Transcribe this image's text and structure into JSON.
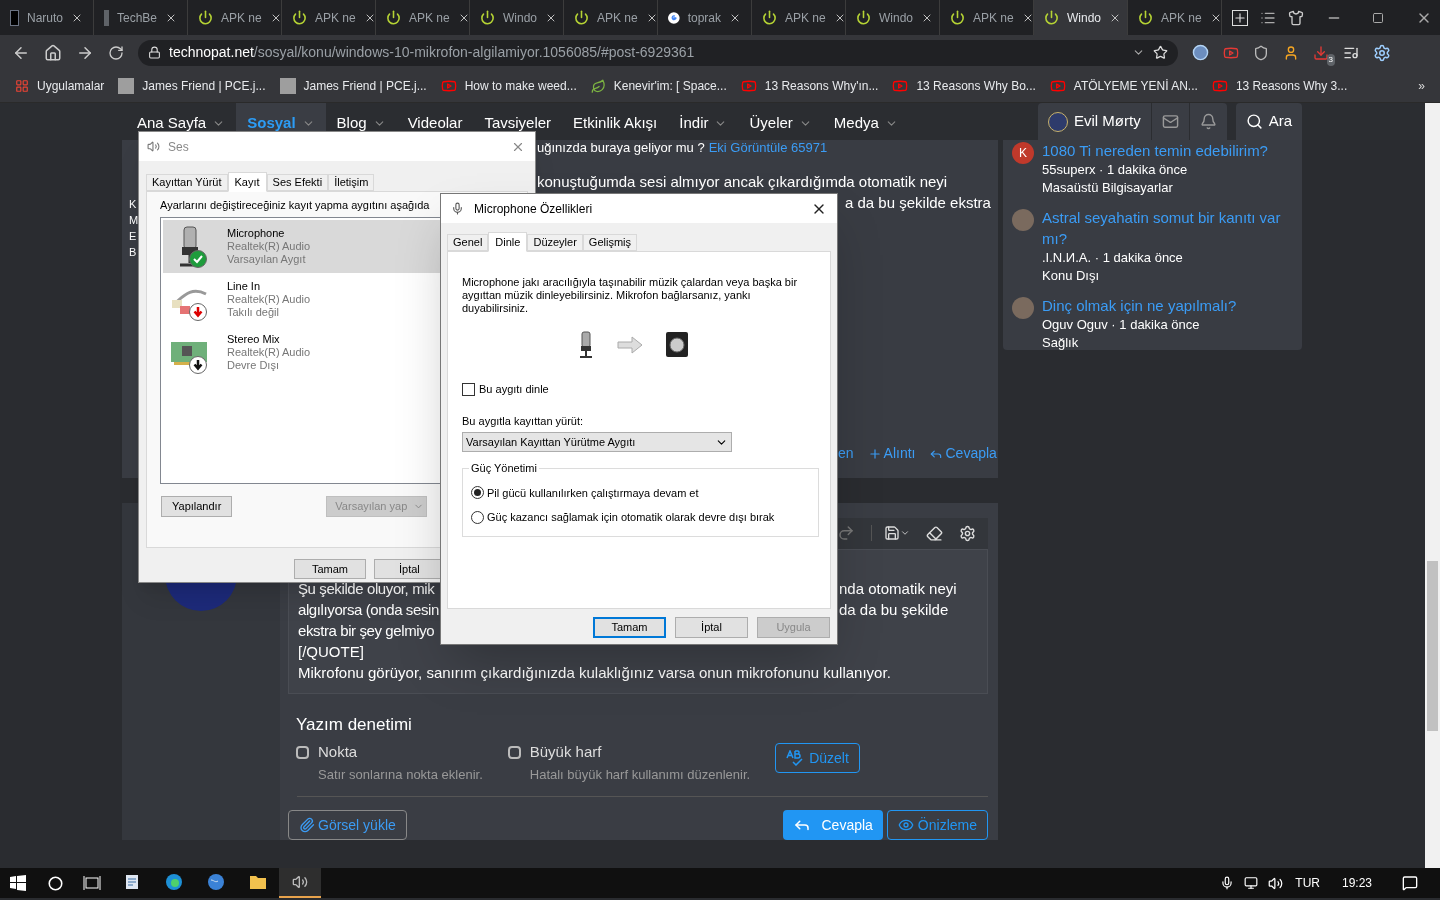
{
  "browser": {
    "tabs": [
      {
        "title": "Naruto",
        "kind": "logo",
        "selected": false
      },
      {
        "title": "TechBe",
        "kind": "blank",
        "selected": false
      },
      {
        "title": "APK ne",
        "kind": "power",
        "selected": false
      },
      {
        "title": "APK ne",
        "kind": "power",
        "selected": false
      },
      {
        "title": "APK ne",
        "kind": "power",
        "selected": false
      },
      {
        "title": "Windo",
        "kind": "power",
        "selected": false
      },
      {
        "title": "APK ne",
        "kind": "power",
        "selected": false
      },
      {
        "title": "toprak",
        "kind": "google",
        "selected": false
      },
      {
        "title": "APK ne",
        "kind": "power",
        "selected": false
      },
      {
        "title": "Windo",
        "kind": "power",
        "selected": false
      },
      {
        "title": "APK ne",
        "kind": "power",
        "selected": false
      },
      {
        "title": "Windo",
        "kind": "power",
        "selected": true
      },
      {
        "title": "APK ne",
        "kind": "power",
        "selected": false
      }
    ],
    "address": {
      "domain": "technopat.net",
      "path": "/sosyal/konu/windows-10-mikrofon-algilamiyor.1056085/#post-6929361"
    },
    "extension_badge": "3",
    "bookmarks": [
      {
        "label": "Uygulamalar",
        "kind": "apps"
      },
      {
        "label": "James Friend | PCE.j...",
        "kind": "avatar"
      },
      {
        "label": "James Friend | PCE.j...",
        "kind": "avatar"
      },
      {
        "label": "How to make weed...",
        "kind": "video"
      },
      {
        "label": "Kenevir'im: [ Space...",
        "kind": "leaf"
      },
      {
        "label": "13 Reasons Why'ın...",
        "kind": "video"
      },
      {
        "label": "13 Reasons Why Bo...",
        "kind": "video"
      },
      {
        "label": "ATÖLYEME YENİ AN...",
        "kind": "video"
      },
      {
        "label": "13 Reasons Why 3...",
        "kind": "video"
      }
    ],
    "more_bookmarks": "»"
  },
  "site_nav": {
    "items": [
      {
        "label": "Ana Sayfa",
        "menu": true,
        "selected": false
      },
      {
        "label": "Sosyal",
        "menu": true,
        "selected": true
      },
      {
        "label": "Blog",
        "menu": true,
        "selected": false
      },
      {
        "label": "Videolar",
        "menu": false,
        "selected": false
      },
      {
        "label": "Tavsiyeler",
        "menu": false,
        "selected": false
      },
      {
        "label": "Etkinlik Akışı",
        "menu": false,
        "selected": false
      },
      {
        "label": "İndir",
        "menu": true,
        "selected": false
      },
      {
        "label": "Üyeler",
        "menu": true,
        "selected": false
      },
      {
        "label": "Medya",
        "menu": true,
        "selected": false
      }
    ],
    "user": "Evil Mørty",
    "search": "Ara"
  },
  "post": {
    "top_text": "uğınızda buraya geliyor mu ?",
    "attachment_link": "Eki Görüntüle 65971",
    "left_fragments": [
      "K",
      "M",
      "E",
      "B"
    ],
    "line_1": "konuştuğumda sesi almıyor ancak çıkardığımda otomatik neyi",
    "line_2": "a da bu şekilde ekstra",
    "actions": [
      "en",
      "Alıntı",
      "Cevapla"
    ]
  },
  "editor": {
    "lines": [
      {
        "left": "Şu şekilde oluyor, mik",
        "right": "nda otomatik neyi"
      },
      {
        "left": "algılıyorsa (onda sesin",
        "right": "da da bu şekilde"
      },
      {
        "left": "ekstra bir şey gelmiyo"
      }
    ],
    "full_lines": [
      "[/QUOTE]",
      "Mikrofonu görüyor, sanırım çıkardığınızda kulaklığınız varsa onun mikrofonunu kullanıyor."
    ],
    "spellcheck": {
      "title": "Yazım denetimi",
      "options": [
        {
          "label": "Nokta",
          "hint": "Satır sonlarına nokta eklenir.",
          "checked": false
        },
        {
          "label": "Büyük harf",
          "hint": "Hatalı büyük harf kullanımı düzenlenir.",
          "checked": false
        }
      ],
      "fix_button": "Düzelt"
    },
    "upload_button": "Görsel yükle",
    "reply_button": "Cevapla",
    "preview_button": "Önizleme"
  },
  "sidebar": {
    "items": [
      {
        "title": "1080 Ti nereden temin edebilirim?",
        "meta": "55superx · 1 dakika önce",
        "category": "Masaüstü Bilgisayarlar",
        "avatar_letter": "K",
        "color": "#c0392b"
      },
      {
        "title": "Astral seyahatin somut bir kanıtı var mı?",
        "meta": ".I.N.И.A. · 1 dakika önce",
        "category": "Konu Dışı"
      },
      {
        "title": "Dinç olmak için ne yapılmalı?",
        "meta": "Oguv Oguv · 1 dakika önce",
        "category": "Sağlık"
      }
    ]
  },
  "ses_dialog": {
    "title": "Ses",
    "tabs": [
      {
        "label": "Kayıttan Yürüt",
        "selected": false
      },
      {
        "label": "Kayıt",
        "selected": true
      },
      {
        "label": "Ses Efekti",
        "selected": false
      },
      {
        "label": "İletişim",
        "selected": false
      }
    ],
    "instruction": "Ayarlarını değiştireceğiniz kayıt yapma aygıtını aşağıda",
    "devices": [
      {
        "name": "Microphone",
        "driver": "Realtek(R) Audio",
        "status_text": "Varsayılan Aygıt",
        "kind": "microphone",
        "default": true,
        "plugged_in": true,
        "enabled": true,
        "selected": true
      },
      {
        "name": "Line In",
        "driver": "Realtek(R) Audio",
        "status_text": "Takılı değil",
        "kind": "cable",
        "default": false,
        "plugged_in": false,
        "enabled": true,
        "selected": false
      },
      {
        "name": "Stereo Mix",
        "driver": "Realtek(R) Audio",
        "status_text": "Devre Dışı",
        "kind": "board",
        "default": false,
        "plugged_in": true,
        "enabled": false,
        "selected": false
      }
    ],
    "configure_button": "Yapılandır",
    "default_button": {
      "label": "Varsayılan yap",
      "disabled": true
    },
    "ok_button": "Tamam",
    "cancel_button": "İptal"
  },
  "mic_dialog": {
    "title": "Microphone Özellikleri",
    "tabs": [
      {
        "label": "Genel",
        "selected": false
      },
      {
        "label": "Dinle",
        "selected": true
      },
      {
        "label": "Düzeyler",
        "selected": false
      },
      {
        "label": "Gelişmiş",
        "selected": false
      }
    ],
    "description": "Microphone jakı aracılığıyla taşınabilir müzik çalardan veya başka bir aygıttan müzik dinleyebilirsiniz. Mikrofon bağlarsanız, yankı duyabilirsiniz.",
    "listen_checkbox": {
      "label": "Bu aygıtı dinle",
      "checked": false
    },
    "playback_label": "Bu aygıtla kayıttan yürüt:",
    "playback_select": "Varsayılan Kayıttan Yürütme Aygıtı",
    "power_group": "Güç Yönetimi",
    "power_options": [
      {
        "label": "Pil gücü kullanılırken çalıştırmaya devam et",
        "selected": true
      },
      {
        "label": "Güç kazancı sağlamak için otomatik olarak devre dışı bırak",
        "selected": false
      }
    ],
    "buttons": [
      {
        "label": "Tamam",
        "kind": "default",
        "disabled": false
      },
      {
        "label": "İptal",
        "kind": "normal",
        "disabled": false
      },
      {
        "label": "Uygula",
        "kind": "normal",
        "disabled": true
      }
    ]
  },
  "taskbar": {
    "apps": [
      {
        "kind": "document",
        "active": false
      },
      {
        "kind": "edge",
        "active": false
      },
      {
        "kind": "globe",
        "active": false
      },
      {
        "kind": "folder",
        "active": false
      },
      {
        "kind": "speaker",
        "active": true
      }
    ],
    "language": "TUR",
    "time": "19:23"
  }
}
